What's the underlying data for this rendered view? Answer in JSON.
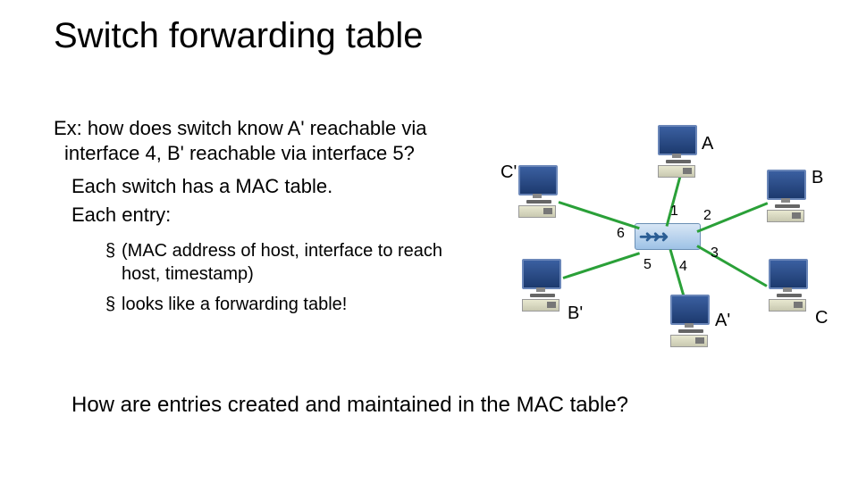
{
  "title": "Switch forwarding table",
  "question_line1": "Ex: how does switch know A' reachable via",
  "question_line2": "interface 4, B' reachable via interface 5?",
  "body_line1": "Each switch has a MAC table.",
  "body_line2": "Each entry:",
  "bullet_marker": "§",
  "bullet1": "(MAC address of host, interface to reach host, timestamp)",
  "bullet2": "looks like a forwarding table!",
  "footer_question": "How are entries created and maintained in the MAC table?",
  "diagram": {
    "hosts": {
      "A": "A",
      "B": "B",
      "C": "C",
      "Aprime": "A'",
      "Bprime": "B'",
      "Cprime": "C'"
    },
    "ports": {
      "p1": "1",
      "p2": "2",
      "p3": "3",
      "p4": "4",
      "p5": "5",
      "p6": "6"
    }
  }
}
